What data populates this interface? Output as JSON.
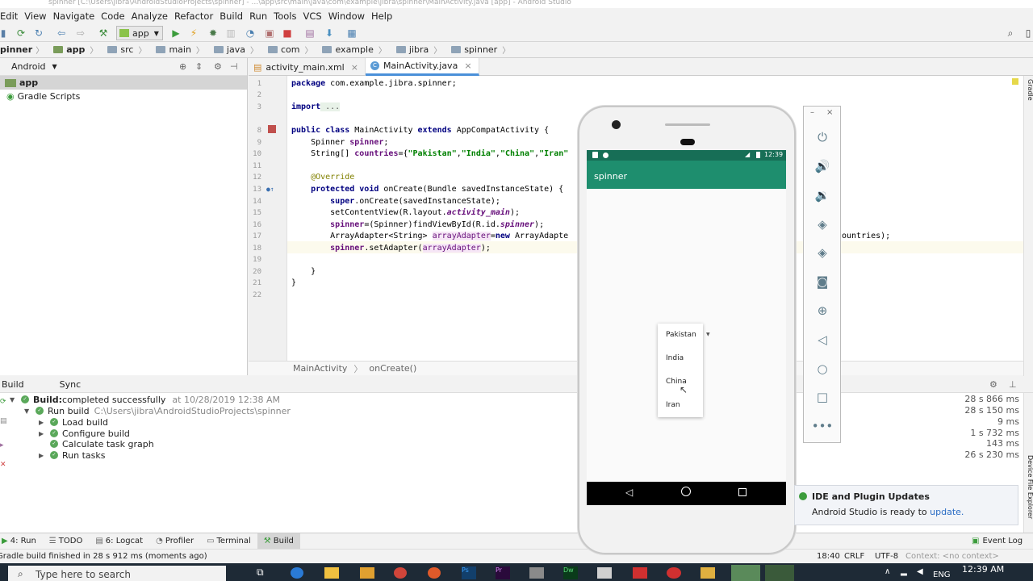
{
  "window": {
    "title_fragment": "spinner [C:\\Users\\jibra\\AndroidStudioProjects\\spinner] - ...\\app\\src\\main\\java\\com\\example\\jibra\\spinner\\MainActivity.java [app] - Android Studio"
  },
  "menu": [
    "Edit",
    "View",
    "Navigate",
    "Code",
    "Analyze",
    "Refactor",
    "Build",
    "Run",
    "Tools",
    "VCS",
    "Window",
    "Help"
  ],
  "toolbar": {
    "config": "app"
  },
  "breadcrumb": [
    "pinner",
    "app",
    "src",
    "main",
    "java",
    "com",
    "example",
    "jibra",
    "spinner"
  ],
  "project": {
    "view": "Android",
    "items": [
      {
        "label": "app",
        "bold": true
      },
      {
        "label": "Gradle Scripts",
        "bold": false
      }
    ]
  },
  "tabs": [
    {
      "label": "activity_main.xml",
      "active": false
    },
    {
      "label": "MainActivity.java",
      "active": true
    }
  ],
  "code": {
    "lines": [
      "1",
      "2",
      "3",
      "8",
      "9",
      "10",
      "11",
      "12",
      "13",
      "14",
      "15",
      "16",
      "17",
      "18",
      "19",
      "20",
      "21",
      "22"
    ],
    "l1_kw": "package",
    "l1_rest": " com.example.jibra.spinner;",
    "l3_kw": "import",
    "l3_rest": " ...",
    "l8_a": "public class",
    "l8_b": " MainActivity ",
    "l8_c": "extends",
    "l8_d": " AppCompatActivity {",
    "l9_a": "    Spinner ",
    "l9_b": "spinner",
    "l9_c": ";",
    "l10_a": "    String[] ",
    "l10_b": "countries",
    "l10_c": "={",
    "l10_s1": "\"Pakistan\"",
    "l10_s2": "\"India\"",
    "l10_s3": "\"China\"",
    "l10_s4": "\"Iran\"",
    "l10_comma": ",",
    "l12": "    @Override",
    "l13_a": "    protected void",
    "l13_b": " onCreate(Bundle savedInstanceState) {",
    "l14_a": "        super",
    "l14_b": ".onCreate(savedInstanceState);",
    "l15_a": "        setContentView(R.layout.",
    "l15_b": "activity_main",
    "l15_c": ");",
    "l16_a": "        spinner",
    "l16_b": "=(Spinner)findViewById(R.id.",
    "l16_c": "spinner",
    "l16_d": ");",
    "l17_a": "        ArrayAdapter<String> ",
    "l17_b": "arrayAdapter",
    "l17_c": "=",
    "l17_d": "new",
    "l17_e": " ArrayAdapte",
    "l17_tail": "ountries);",
    "l18_a": "        spinner",
    "l18_b": ".setAdapter(",
    "l18_c": "arrayAdapter",
    "l18_d": ");",
    "l20": "    }",
    "l21": "}"
  },
  "editor_breadcrumb": [
    "MainActivity",
    "onCreate()"
  ],
  "build": {
    "tabs": [
      "Build",
      "Sync"
    ],
    "rows": [
      {
        "label": "Build:",
        "text": " completed successfully",
        "meta": "at 10/28/2019 12:38 AM",
        "time": "28 s 866 ms"
      },
      {
        "label": "Run build",
        "meta": "C:\\Users\\jibra\\AndroidStudioProjects\\spinner",
        "time": "28 s 150 ms"
      },
      {
        "label": "Load build",
        "time": "9 ms"
      },
      {
        "label": "Configure build",
        "time": "1 s 732 ms"
      },
      {
        "label": "Calculate task graph",
        "time": "143 ms"
      },
      {
        "label": "Run tasks",
        "time": "26 s 230 ms"
      }
    ]
  },
  "bottom_tabs": [
    "4: Run",
    "TODO",
    "6: Logcat",
    "Profiler",
    "Terminal",
    "Build"
  ],
  "event_log": "Event Log",
  "status": {
    "message": "Gradle build finished in 28 s 912 ms (moments ago)",
    "pos": "18:40",
    "crlf": "CRLF",
    "enc": "UTF-8",
    "context": "Context: <no context>"
  },
  "emulator": {
    "status_time": "12:39",
    "app_title": "spinner",
    "colors": {
      "toolbar": "#1e8e6e",
      "statusbar": "#176e56"
    }
  },
  "dropdown": [
    "Pakistan",
    "India",
    "China",
    "Iran"
  ],
  "notification": {
    "title": "IDE and Plugin Updates",
    "text": "Android Studio is ready to ",
    "link": "update."
  },
  "right_strip": {
    "top": "Gradle",
    "bottom": "Device File Explorer"
  },
  "taskbar": {
    "search": "Type here to search",
    "lang": "ENG",
    "time": "12:39 AM"
  }
}
